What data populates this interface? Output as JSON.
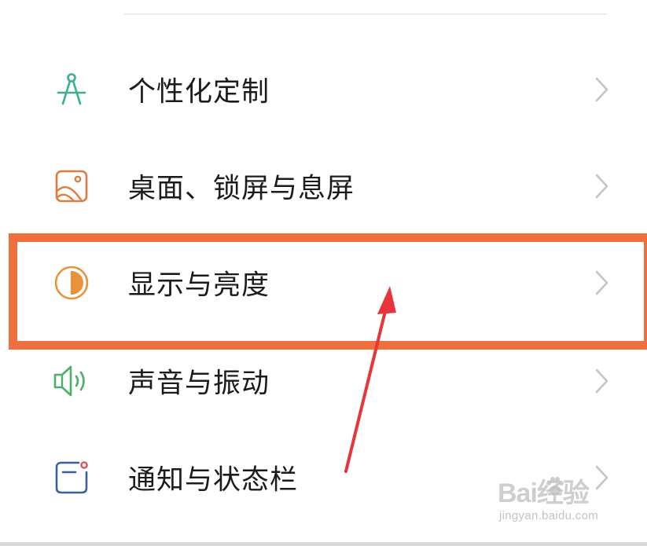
{
  "settings": {
    "items": [
      {
        "label": "个性化定制",
        "icon": "compass-icon"
      },
      {
        "label": "桌面、锁屏与息屏",
        "icon": "wallpaper-icon"
      },
      {
        "label": "显示与亮度",
        "icon": "brightness-icon"
      },
      {
        "label": "声音与振动",
        "icon": "speaker-icon"
      },
      {
        "label": "通知与状态栏",
        "icon": "notification-icon"
      }
    ]
  },
  "annotation": {
    "highlight_color": "#ef6f3c",
    "arrow_color": "#e8343a"
  },
  "watermark": {
    "brand": "Bai经验",
    "url": "jingyan.baidu.com"
  },
  "colors": {
    "compass": "#3bb08f",
    "wallpaper": "#e07a3e",
    "brightness": "#e8923a",
    "speaker": "#4caf6a",
    "notification": "#3d5f9e"
  }
}
